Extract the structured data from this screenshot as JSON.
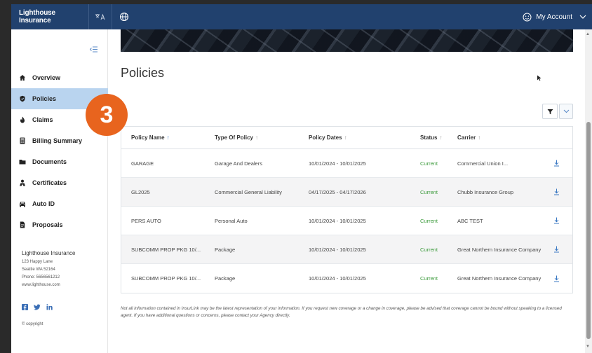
{
  "header": {
    "brand": "Lighthouse Insurance",
    "account_label": "My Account",
    "icons": [
      "language-icon",
      "globe-icon",
      "smiley-icon",
      "chevron-down-icon"
    ]
  },
  "sidebar": {
    "items": [
      {
        "label": "Overview",
        "icon": "home-icon",
        "active": false
      },
      {
        "label": "Policies",
        "icon": "shield-icon",
        "active": true
      },
      {
        "label": "Claims",
        "icon": "flame-icon",
        "active": false
      },
      {
        "label": "Billing Summary",
        "icon": "calculator-icon",
        "active": false
      },
      {
        "label": "Documents",
        "icon": "folder-icon",
        "active": false
      },
      {
        "label": "Certificates",
        "icon": "person-icon",
        "active": false
      },
      {
        "label": "Auto ID",
        "icon": "car-icon",
        "active": false
      },
      {
        "label": "Proposals",
        "icon": "document-icon",
        "active": false
      }
    ],
    "org": {
      "name": "Lighthouse Insurance",
      "address1": "123 Happy Lane",
      "address2": "Seattle WA 52164",
      "phone": "Phone: 5656561212",
      "website": "www.lighthouse.com"
    },
    "copyright": "© copyright"
  },
  "badge": {
    "number": "3",
    "color": "#e8641e"
  },
  "main": {
    "title": "Policies",
    "table": {
      "columns": [
        "Policy Name",
        "Type Of Policy",
        "Policy Dates",
        "Status",
        "Carrier"
      ],
      "rows": [
        {
          "name": "GARAGE",
          "type": "Garage And Dealers",
          "dates": "10/01/2024 - 10/01/2025",
          "status": "Current",
          "carrier": "Commercial Union I..."
        },
        {
          "name": "GL2025",
          "type": "Commercial General Liability",
          "dates": "04/17/2025 - 04/17/2026",
          "status": "Current",
          "carrier": "Chubb Insurance Group"
        },
        {
          "name": "PERS AUTO",
          "type": "Personal Auto",
          "dates": "10/01/2024 - 10/01/2025",
          "status": "Current",
          "carrier": "ABC TEST"
        },
        {
          "name": "SUBCOMM PROP PKG 10/...",
          "type": "Package",
          "dates": "10/01/2024 - 10/01/2025",
          "status": "Current",
          "carrier": "Great Northern Insurance Company"
        },
        {
          "name": "SUBCOMM PROP PKG 10/...",
          "type": "Package",
          "dates": "10/01/2024 - 10/01/2025",
          "status": "Current",
          "carrier": "Great Northern Insurance Company"
        }
      ]
    },
    "disclaimer": "Not all information contained in InsurLink may be the latest representation of your information. If you request new coverage or a change in coverage, please be advised that coverage cannot be bound without speaking to a licensed agent. If you have additional questions or concerns, please contact your Agency directly."
  },
  "colors": {
    "header": "#21416e",
    "active_nav": "#b9d4ef",
    "status_green": "#3a9a3a",
    "link_blue": "#3b79c3"
  }
}
